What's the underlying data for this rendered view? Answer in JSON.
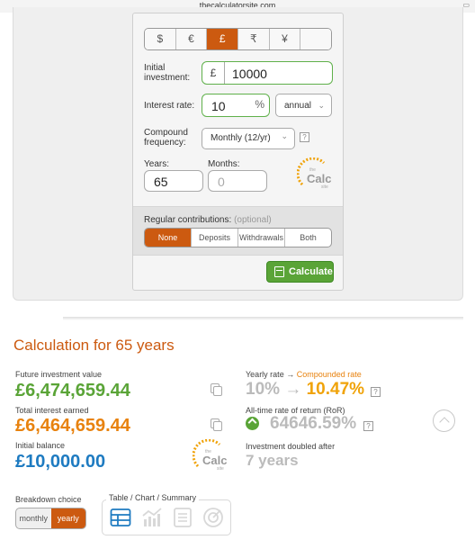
{
  "browser": {
    "url": "thecalculatorsite.com"
  },
  "calculator": {
    "currencies": [
      "$",
      "€",
      "£",
      "₹",
      "¥",
      ""
    ],
    "active_currency": "£",
    "initial_investment": {
      "label": "Initial investment:",
      "prefix": "£",
      "value": "10000"
    },
    "interest_rate": {
      "label": "Interest rate:",
      "value": "10",
      "suffix": "%",
      "period": "annual"
    },
    "compound_frequency": {
      "label": "Compound frequency:",
      "value": "Monthly (12/yr)"
    },
    "years": {
      "label": "Years:",
      "value": "65"
    },
    "months": {
      "label": "Months:",
      "placeholder": "0"
    },
    "help": "?",
    "contributions": {
      "title": "Regular contributions:",
      "optional": "(optional)",
      "options": [
        "None",
        "Deposits",
        "Withdrawals",
        "Both"
      ],
      "active": "None"
    },
    "calculate_label": "Calculate"
  },
  "logo": {
    "top": "the",
    "main": "Calc",
    "bottom": "site",
    "arc": "12345678910"
  },
  "results": {
    "title": "Calculation for 65 years",
    "future_value": {
      "label": "Future investment value",
      "value": "£6,474,659.44"
    },
    "total_interest": {
      "label": "Total interest earned",
      "value": "£6,464,659.44"
    },
    "initial_balance": {
      "label": "Initial balance",
      "value": "£10,000.00"
    },
    "yearly_rate": {
      "label": "Yearly rate",
      "arrow": "→",
      "label2": "Compounded rate",
      "rate": "10%",
      "compounded": "10.47%"
    },
    "ror": {
      "label": "All-time rate of return (RoR)",
      "value": "64646.59%"
    },
    "doubled": {
      "label": "Investment doubled after",
      "value": "7 years"
    }
  },
  "breakdown": {
    "label": "Breakdown choice",
    "options": [
      "monthly",
      "yearly"
    ],
    "active": "yearly",
    "view_label": "Table / Chart / Summary"
  },
  "colors": {
    "accent": "#cc5a10",
    "green": "#5aa437",
    "orange": "#e8820e",
    "blue": "#1e7bc1",
    "muted": "#bbbbbb"
  }
}
